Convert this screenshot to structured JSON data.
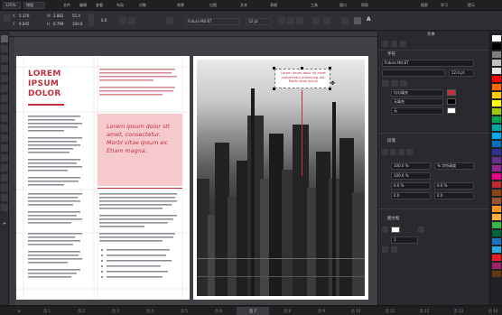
{
  "menubar": {
    "zoom": "125%",
    "view_mode": "增强",
    "items": [
      "文件",
      "编辑",
      "查看",
      "布局",
      "对象",
      "效果",
      "位图",
      "文本",
      "表格",
      "工具",
      "窗口",
      "帮助"
    ],
    "right_items": [
      "搜索",
      "学习",
      "提示"
    ]
  },
  "toolbar": {
    "x_label": "X",
    "x_value": "5.370",
    "y_label": "Y",
    "y_value": "9.845",
    "w_label": "W",
    "w_value": "2.862",
    "h_label": "H",
    "h_value": "0.799",
    "sx_value": "55.4",
    "sy_value": "100.0",
    "angle_value": "0.0",
    "font_name": "Futura Md BT",
    "font_size": "12 pt",
    "glyph_label": "A"
  },
  "document": {
    "left_page": {
      "headline": [
        "LOREM",
        "IPSUM",
        "DOLOR"
      ],
      "pullquote": "Lorem ipsum dolor sit amet, consectetur. Morbi vitae ipsum ex. Etiam magna."
    },
    "right_page": {
      "selected_text": "Lorem ipsum dolor sit amet consectetur adipiscing elit. Morbi vitae ipsum"
    }
  },
  "page_tabs": [
    "页 1",
    "页 2",
    "页 3",
    "页 4",
    "页 5",
    "页 6",
    "页 7",
    "页 8",
    "页 9",
    "页 10",
    "页 11",
    "页 12",
    "页 13",
    "页 14"
  ],
  "active_page_tab": 6,
  "panel": {
    "title": "文本",
    "character_section": "字符",
    "font": "Futura Md BT",
    "font_style": "",
    "font_size": "12.0 pt",
    "fill_label": "均匀填充",
    "outline_label": "无填充",
    "underline_label": "无",
    "paragraph_section": "段落",
    "line_spacing": "100.0 %",
    "line_spacing_unit": "% 字符高度",
    "char_spacing": "100.0 %",
    "indent_before": "0.0 %",
    "indent_after": "0.0 %",
    "space_before": "0.0",
    "space_after": "0.0",
    "frame_section": "图文框",
    "frame_columns": "1"
  },
  "palette_colors": [
    "#ffffff",
    "#000000",
    "#7f7f7f",
    "#c0c0c0",
    "#e5e5e5",
    "#ff0000",
    "#ff6600",
    "#ffcc00",
    "#ffff00",
    "#99cc00",
    "#00a651",
    "#00a99d",
    "#00aeef",
    "#0072bc",
    "#2e3192",
    "#662d91",
    "#92278f",
    "#ec008c",
    "#c1272d",
    "#8b4513",
    "#a0522d",
    "#f7941d",
    "#fbb040",
    "#39b54a",
    "#006838",
    "#1b75bc",
    "#27aae1",
    "#ed1c24",
    "#9e1f63",
    "#603913"
  ],
  "colors": {
    "accent_red": "#c03040",
    "pink": "#f6c9cc"
  }
}
